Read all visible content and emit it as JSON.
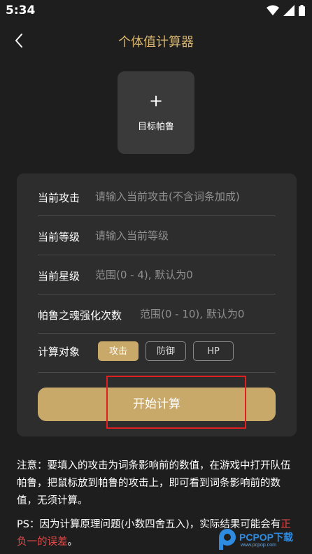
{
  "status_bar": {
    "time": "5:34"
  },
  "nav": {
    "title": "个体值计算器"
  },
  "target": {
    "plus": "+",
    "label": "目标帕鲁"
  },
  "form": {
    "rows": [
      {
        "label": "当前攻击",
        "placeholder": "请输入当前攻击(不含词条加成)"
      },
      {
        "label": "当前等级",
        "placeholder": "请输入当前等级"
      },
      {
        "label": "当前星级",
        "placeholder": "范围(0 - 4), 默认为0"
      },
      {
        "label": "帕鲁之魂强化次数",
        "placeholder": "范围(0 - 10), 默认为0"
      }
    ],
    "target_label": "计算对象",
    "options": [
      "攻击",
      "防御",
      "HP"
    ],
    "selected_option": "攻击",
    "start_label": "开始计算"
  },
  "notes": {
    "note1": "注意：要填入的攻击为词条影响前的数值，在游戏中打开队伍帕鲁，把鼠标放到帕鲁的攻击上，即可看到词条影响前的数值，无须计算。",
    "ps_prefix": "PS：因为计算原理问题(小数四舍五入)，实际结果可能会有",
    "ps_red": "正负一的误差",
    "ps_suffix": "。"
  },
  "watermark": {
    "text": "PCPOP下载",
    "sub": "www.pcpop.com"
  },
  "colors": {
    "accent": "#c8a96a",
    "title": "#d6b46f",
    "highlight": "#e02020",
    "warning": "#e24a4a"
  }
}
